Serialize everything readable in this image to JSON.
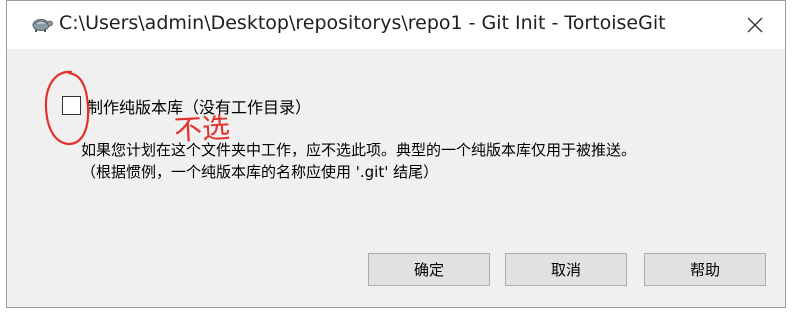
{
  "window": {
    "title": "C:\\Users\\admin\\Desktop\\repositorys\\repo1 - Git Init - TortoiseGit",
    "app_icon": "tortoisegit-icon",
    "close_icon": "close-icon"
  },
  "options": {
    "bare_repo_label": "制作纯版本库（没有工作目录）",
    "bare_repo_checked": false,
    "description_line1": "如果您计划在这个文件夹中工作，应不选此项。典型的一个纯版本库仅用于被推送。",
    "description_line2": "（根据惯例，一个纯版本库的名称应使用 '.git' 结尾）"
  },
  "annotation": {
    "text": "不选",
    "color": "#e1322d"
  },
  "buttons": {
    "ok": "确定",
    "cancel": "取消",
    "help": "帮助"
  }
}
